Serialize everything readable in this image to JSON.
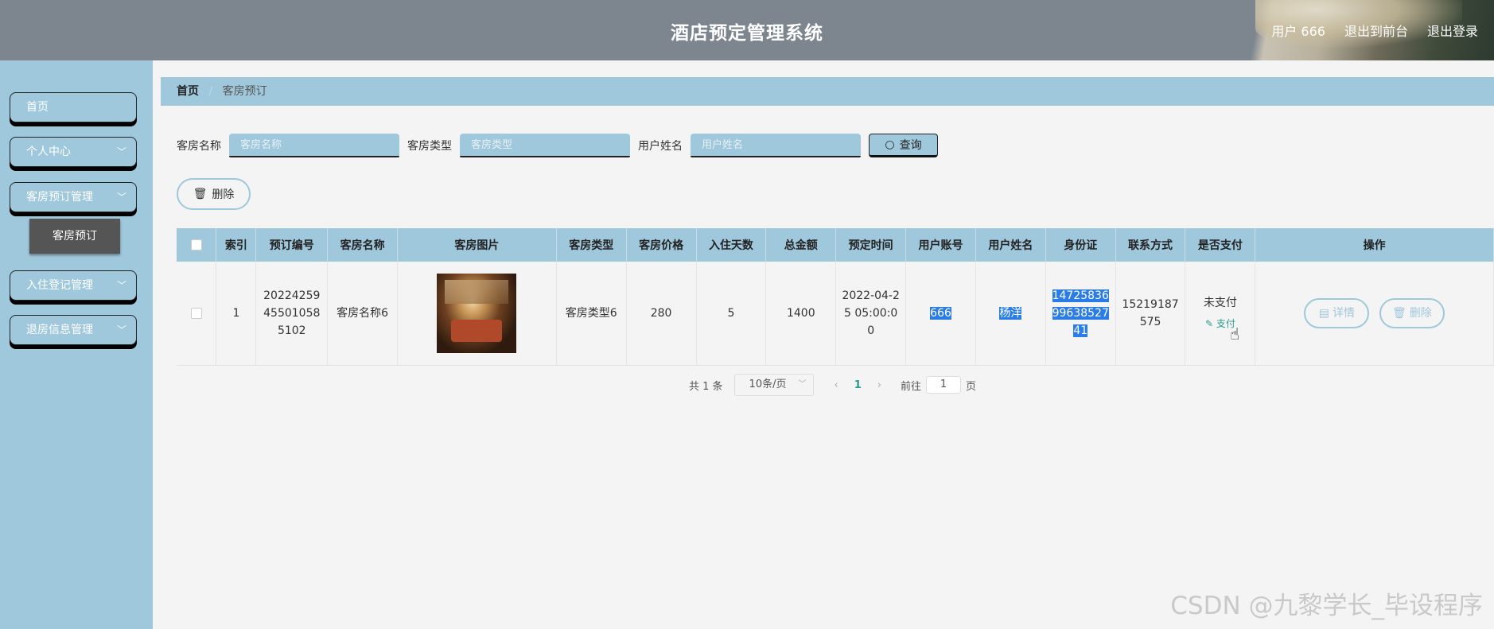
{
  "header": {
    "title": "酒店预定管理系统",
    "user": "用户 666",
    "front_link": "退出到前台",
    "logout_link": "退出登录"
  },
  "sidebar": {
    "items": [
      {
        "label": "首页"
      },
      {
        "label": "个人中心"
      },
      {
        "label": "客房预订管理"
      },
      {
        "label": "入住登记管理"
      },
      {
        "label": "退房信息管理"
      }
    ],
    "submenu_active": "客房预订"
  },
  "breadcrumb": {
    "home": "首页",
    "sep": "/",
    "current": "客房预订"
  },
  "search": {
    "room_name_label": "客房名称",
    "room_name_placeholder": "客房名称",
    "room_type_label": "客房类型",
    "room_type_placeholder": "客房类型",
    "user_name_label": "用户姓名",
    "user_name_placeholder": "用户姓名",
    "query_label": "查询"
  },
  "actions": {
    "delete_label": "删除"
  },
  "table": {
    "headers": [
      "索引",
      "预订编号",
      "客房名称",
      "客房图片",
      "客房类型",
      "客房价格",
      "入住天数",
      "总金额",
      "预定时间",
      "用户账号",
      "用户姓名",
      "身份证",
      "联系方式",
      "是否支付",
      "操作"
    ],
    "rows": [
      {
        "index": "1",
        "order_no": "20224259455010585102",
        "room_name": "客房名称6",
        "room_type": "客房类型6",
        "price": "280",
        "days": "5",
        "total": "1400",
        "time": "2022-04-25 05:00:00",
        "account": "666",
        "username": "杨洋",
        "id_card": "1472583699638527 41",
        "phone": "15219187575",
        "pay_status": "未支付",
        "pay_link": "支付",
        "detail_btn": "详情",
        "delete_btn": "删除"
      }
    ]
  },
  "pager": {
    "total": "共 1 条",
    "page_size": "10条/页",
    "current_page": "1",
    "goto_label": "前往",
    "goto_value": "1",
    "page_unit": "页"
  },
  "watermark": "CSDN @九黎学长_毕设程序",
  "colors": {
    "accent": "#a0c8dc",
    "header_bg": "#7d868f",
    "highlight": "#2a7ce6",
    "pay_link": "#2a9c8c"
  }
}
